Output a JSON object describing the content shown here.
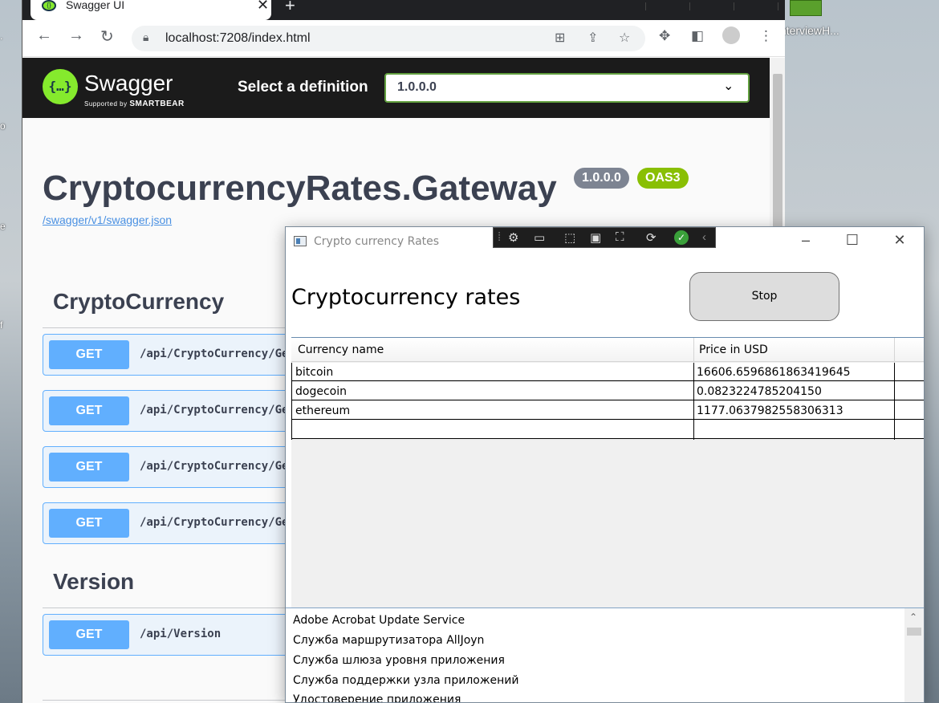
{
  "desktop": {
    "icon_label": "InterviewH..."
  },
  "browser": {
    "tab_title": "Swagger UI",
    "url": "localhost:7208/index.html"
  },
  "swagger": {
    "brand": "Swagger",
    "brand_sub_prefix": "Supported by",
    "brand_sub_company": "SMARTBEAR",
    "definition_label": "Select a definition",
    "definition_value": "1.0.0.0",
    "api_title": "CryptocurrencyRates.Gateway",
    "version_badge": "1.0.0.0",
    "oas_badge": "OAS3",
    "spec_link": "/swagger/v1/swagger.json",
    "sections": [
      {
        "name": "CryptoCurrency",
        "ops": [
          {
            "method": "GET",
            "path": "/api/CryptoCurrency/Get"
          },
          {
            "method": "GET",
            "path": "/api/CryptoCurrency/Get"
          },
          {
            "method": "GET",
            "path": "/api/CryptoCurrency/Get"
          },
          {
            "method": "GET",
            "path": "/api/CryptoCurrency/Get"
          }
        ]
      },
      {
        "name": "Version",
        "ops": [
          {
            "method": "GET",
            "path": "/api/Version"
          }
        ]
      }
    ]
  },
  "app": {
    "window_title": "Crypto currency Rates",
    "heading": "Cryptocurrency rates",
    "stop_button": "Stop",
    "grid": {
      "columns": [
        "Currency name",
        "Price in USD"
      ],
      "rows": [
        [
          "bitcoin",
          "16606.6596861863419645"
        ],
        [
          "dogecoin",
          "0.0823224785204150"
        ],
        [
          "ethereum",
          "1177.0637982558306313"
        ]
      ]
    },
    "services": [
      "Adobe Acrobat Update Service",
      "Служба маршрутизатора AllJoyn",
      "Служба шлюза уровня приложения",
      "Служба поддержки узла приложений",
      "Удостоверение приложения"
    ]
  },
  "colors": {
    "swagger_green": "#85ea2d",
    "get_blue": "#61affe",
    "badge_gray": "#7d8492",
    "badge_green": "#89bf04"
  }
}
